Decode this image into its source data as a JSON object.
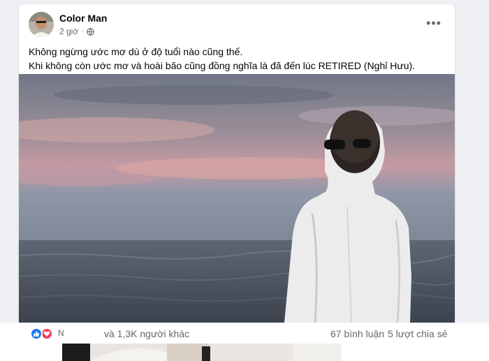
{
  "post": {
    "author": "Color Man",
    "time": "2 giờ",
    "separator": "·",
    "more_label": "•••",
    "text_line1": "Không ngừng ước mơ dù ở độ tuổi nào cũng thế.",
    "text_line2": "Khi không còn ước mơ và hoài bão cũng đồng nghĩa là đã đến lúc RETIRED (Nghỉ Hưu).",
    "photo_icon": "photo-sunset-man-by-sea",
    "privacy_icon": "globe-icon"
  },
  "reactions": {
    "partial_label": "Ν",
    "summary": "và 1,3K người khác",
    "comments": "67 bình luận",
    "shares": "5 lượt chia sẻ",
    "icons": [
      "like-icon",
      "love-icon"
    ]
  },
  "colors": {
    "accent": "#1877f2",
    "love": "#f33e58",
    "secondary_text": "#65676b",
    "page_bg": "#eef0f3"
  }
}
